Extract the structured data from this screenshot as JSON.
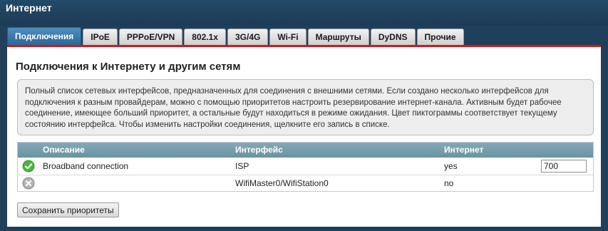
{
  "app": {
    "title": "Интернет"
  },
  "tabs": [
    {
      "label": "Подключения",
      "active": true
    },
    {
      "label": "IPoE"
    },
    {
      "label": "PPPoE/VPN"
    },
    {
      "label": "802.1x"
    },
    {
      "label": "3G/4G"
    },
    {
      "label": "Wi-Fi"
    },
    {
      "label": "Маршруты"
    },
    {
      "label": "DyDNS"
    },
    {
      "label": "Прочие"
    }
  ],
  "page": {
    "title": "Подключения к Интернету и другим сетям"
  },
  "info": {
    "text": "Полный список сетевых интерфейсов, предназначенных для соединения с внешними сетями. Если создано несколько интерфейсов для подключения к разным провайдерам, можно с помощью приоритетов настроить резервирование интернет-канала. Активным будет рабочее соединение, имеющее больший приоритет, а остальные будут находиться в режиме ожидания. Цвет пиктограммы соответствует текущему состоянию интерфейса. Чтобы изменить настройки соединения, щелкните его запись в списке."
  },
  "table": {
    "headers": {
      "description": "Описание",
      "interface": "Интерфейс",
      "internet": "Интернет"
    },
    "rows": [
      {
        "status_icon": "check-circle-icon",
        "status_color": "#3a9d2a",
        "description": "Broadband connection",
        "interface": "ISP",
        "internet": "yes",
        "priority": "700"
      },
      {
        "status_icon": "x-circle-icon",
        "status_color": "#a8a8a8",
        "description": "",
        "interface": "WifiMaster0/WifiStation0",
        "internet": "no"
      }
    ]
  },
  "actions": {
    "save_priorities": "Сохранить приоритеты"
  },
  "colors": {
    "accent": "#2c6797",
    "tab_underline": "#c41e1e",
    "header_bg": "#6a93a2",
    "background": "#1f3f5a"
  }
}
